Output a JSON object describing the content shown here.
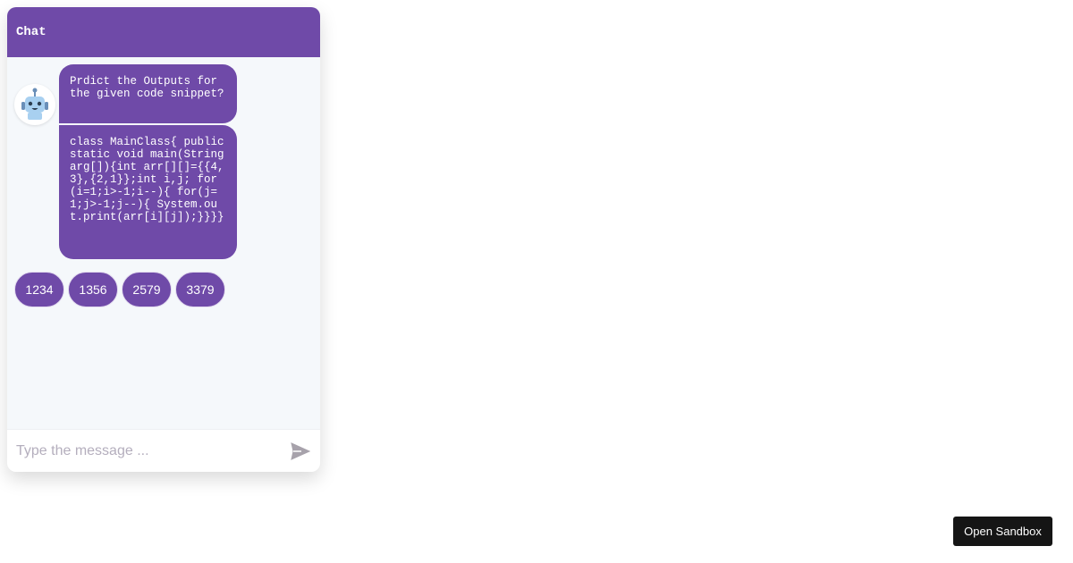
{
  "chat": {
    "title": "Chat",
    "messages": [
      "Prdict the Outputs for the given code snippet?",
      "class MainClass{ public static void main(String arg[]){int arr[][]={{4,3},{2,1}};int i,j; for(i=1;i>-1;i--){ for(j=1;j>-1;j--){ System.out.print(arr[i][j]);}}}}"
    ],
    "options": [
      "1234",
      "1356",
      "2579",
      "3379"
    ],
    "input_placeholder": "Type the message ...",
    "avatar_icon": "robot-icon",
    "send_icon": "send-icon"
  },
  "sandbox": {
    "label": "Open Sandbox"
  },
  "colors": {
    "accent": "#6f4aa8",
    "chat_background": "#f5f8fb",
    "sandbox_button": "#151515"
  }
}
